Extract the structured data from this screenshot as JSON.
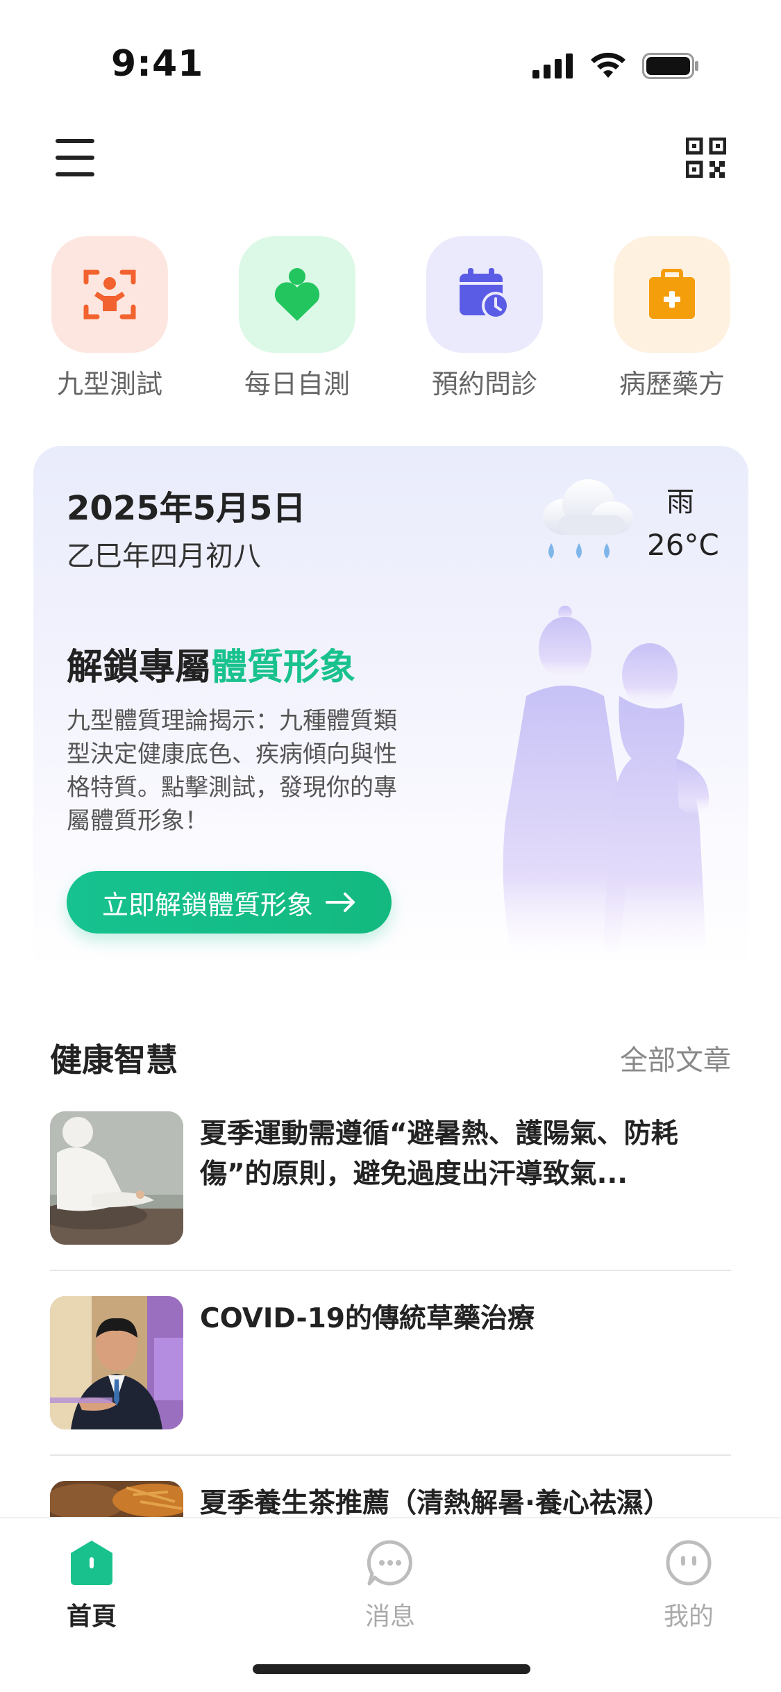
{
  "status": {
    "time": "9:41"
  },
  "quick_actions": [
    {
      "label": "九型測試",
      "icon": "body-scan-icon",
      "color": "#f2622e",
      "bg": "#fde6e0"
    },
    {
      "label": "每日自測",
      "icon": "person-heart-icon",
      "color": "#22c55e",
      "bg": "#dcf8e6"
    },
    {
      "label": "預約問診",
      "icon": "calendar-clock-icon",
      "color": "#5b5ce6",
      "bg": "#ebeafd"
    },
    {
      "label": "病歷藥方",
      "icon": "medical-kit-icon",
      "color": "#f59e0b",
      "bg": "#fef1e0"
    }
  ],
  "hero": {
    "date": "2025年5月5日",
    "lunar": "乙巳年四月初八",
    "weather_condition": "雨",
    "temperature": "26°C",
    "title_main": "解鎖專屬",
    "title_accent": "體質形象",
    "description": "九型體質理論揭示：九種體質類型決定健康底色、疾病傾向與性格特質。點擊測試，發現你的專屬體質形象！",
    "button_label": "立即解鎖體質形象"
  },
  "section": {
    "title": "健康智慧",
    "more": "全部文章"
  },
  "articles": [
    {
      "title": "夏季運動需遵循“避暑熱、護陽氣、防耗傷”的原則，避免過度出汗導致氣..."
    },
    {
      "title": "COVID-19的傳統草藥治療"
    },
    {
      "title": "夏季養生茶推薦（清熱解暑·養心祛濕）"
    }
  ],
  "tabs": [
    {
      "label": "首頁",
      "icon": "home-icon",
      "active": true
    },
    {
      "label": "消息",
      "icon": "message-icon",
      "active": false
    },
    {
      "label": "我的",
      "icon": "profile-icon",
      "active": false
    }
  ],
  "colors": {
    "accent": "#19c28d",
    "text": "#222222",
    "muted": "#888888"
  }
}
